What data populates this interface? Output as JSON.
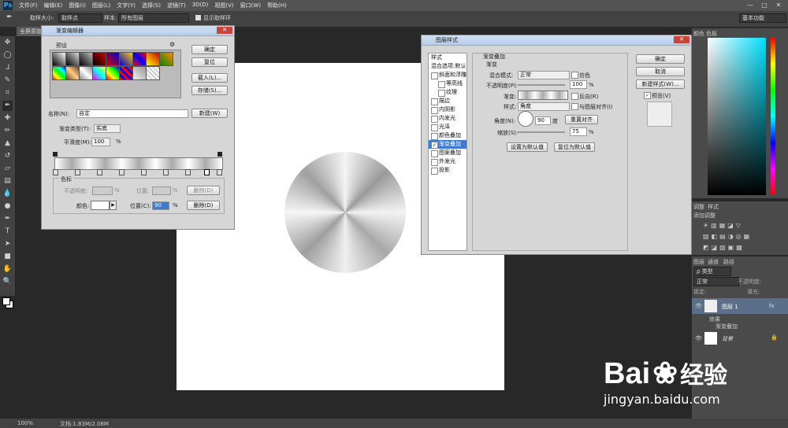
{
  "menubar": {
    "logo": "Ps",
    "menus": [
      "文件(F)",
      "编辑(E)",
      "图像(I)",
      "图层(L)",
      "文字(Y)",
      "选择(S)",
      "滤镜(T)",
      "3D(D)",
      "视图(V)",
      "窗口(W)",
      "帮助(H)"
    ],
    "min": "—",
    "max": "□",
    "close": "✕"
  },
  "optbar": {
    "sample_size_label": "取样大小:",
    "sample_size_value": "取样点",
    "sample_label": "样本:",
    "sample_value": "所有图层",
    "show_ring": "显示取样环",
    "workspace": "基本功能"
  },
  "doc_tab": "全屏原始",
  "status": {
    "zoom": "100%",
    "doc": "文档:1.83M/2.08M"
  },
  "gradient_editor": {
    "title": "渐变编辑器",
    "presets_label": "预设",
    "ok": "确定",
    "reset": "复位",
    "load": "载入(L)...",
    "save": "存储(S)...",
    "name_label": "名称(N):",
    "name_value": "自定",
    "new": "新建(W)",
    "type_label": "渐变类型(T):",
    "type_value": "实底",
    "smooth_label": "平滑度(M):",
    "smooth_value": "100",
    "smooth_unit": "%",
    "stops_label": "色标",
    "opacity_label": "不透明度:",
    "opacity_unit": "%",
    "pos_label_1": "位置:",
    "pos_unit": "%",
    "delete": "删除(D)",
    "color_label": "颜色:",
    "pos_label_2": "位置(C):",
    "pos_value": "90",
    "delete2": "删除(D)"
  },
  "layer_style": {
    "title": "图层样式",
    "styles_header": "样式",
    "blend_default": "混合选项:默认",
    "items": [
      {
        "label": "斜面和浮雕",
        "checked": false,
        "indent": false
      },
      {
        "label": "等高线",
        "checked": false,
        "indent": true
      },
      {
        "label": "纹理",
        "checked": false,
        "indent": true
      },
      {
        "label": "描边",
        "checked": false,
        "indent": false
      },
      {
        "label": "内阴影",
        "checked": false,
        "indent": false
      },
      {
        "label": "内发光",
        "checked": false,
        "indent": false
      },
      {
        "label": "光泽",
        "checked": false,
        "indent": false
      },
      {
        "label": "颜色叠加",
        "checked": false,
        "indent": false
      },
      {
        "label": "渐变叠加",
        "checked": true,
        "indent": false,
        "active": true
      },
      {
        "label": "图案叠加",
        "checked": false,
        "indent": false
      },
      {
        "label": "外发光",
        "checked": false,
        "indent": false
      },
      {
        "label": "投影",
        "checked": false,
        "indent": false
      }
    ],
    "section_title": "渐变叠加",
    "sub_title": "渐变",
    "blend_mode_label": "混合模式:",
    "blend_mode_value": "正常",
    "dither": "仿色",
    "opacity_label": "不透明度(P):",
    "opacity_value": "100",
    "opacity_unit": "%",
    "gradient_label": "渐变:",
    "reverse": "反向(R)",
    "style_label": "样式:",
    "style_value": "角度",
    "align": "与图层对齐(I)",
    "angle_label": "角度(N):",
    "angle_value": "90",
    "angle_unit": "度",
    "reset_align": "重置对齐",
    "scale_label": "缩放(S):",
    "scale_value": "75",
    "scale_unit": "%",
    "set_default": "设置为默认值",
    "reset_default": "复位为默认值",
    "ok": "确定",
    "cancel": "取消",
    "new_style": "新建样式(W)...",
    "preview": "预览(V)"
  },
  "panels": {
    "color_tabs": [
      "颜色",
      "色板"
    ],
    "adj_tabs": [
      "调整",
      "样式"
    ],
    "adj_add": "添加调整",
    "layer_tabs": [
      "图层",
      "通道",
      "路径"
    ],
    "kind": "ρ 类型",
    "mode": "正常",
    "opacity_label": "不透明度:",
    "lock_label": "锁定:",
    "fill_label": "填充:",
    "layers": [
      {
        "name": "图层 1",
        "fx": "fx"
      },
      {
        "name": "效果"
      },
      {
        "name": "渐变叠加"
      },
      {
        "name": "背景"
      }
    ]
  },
  "watermark": {
    "brand": "Bai",
    "brand2": "经验",
    "url": "jingyan.baidu.com"
  },
  "colors": {
    "selection": "#3a7bd5",
    "ui_dark": "#282828",
    "panel": "#4a4a4a"
  }
}
